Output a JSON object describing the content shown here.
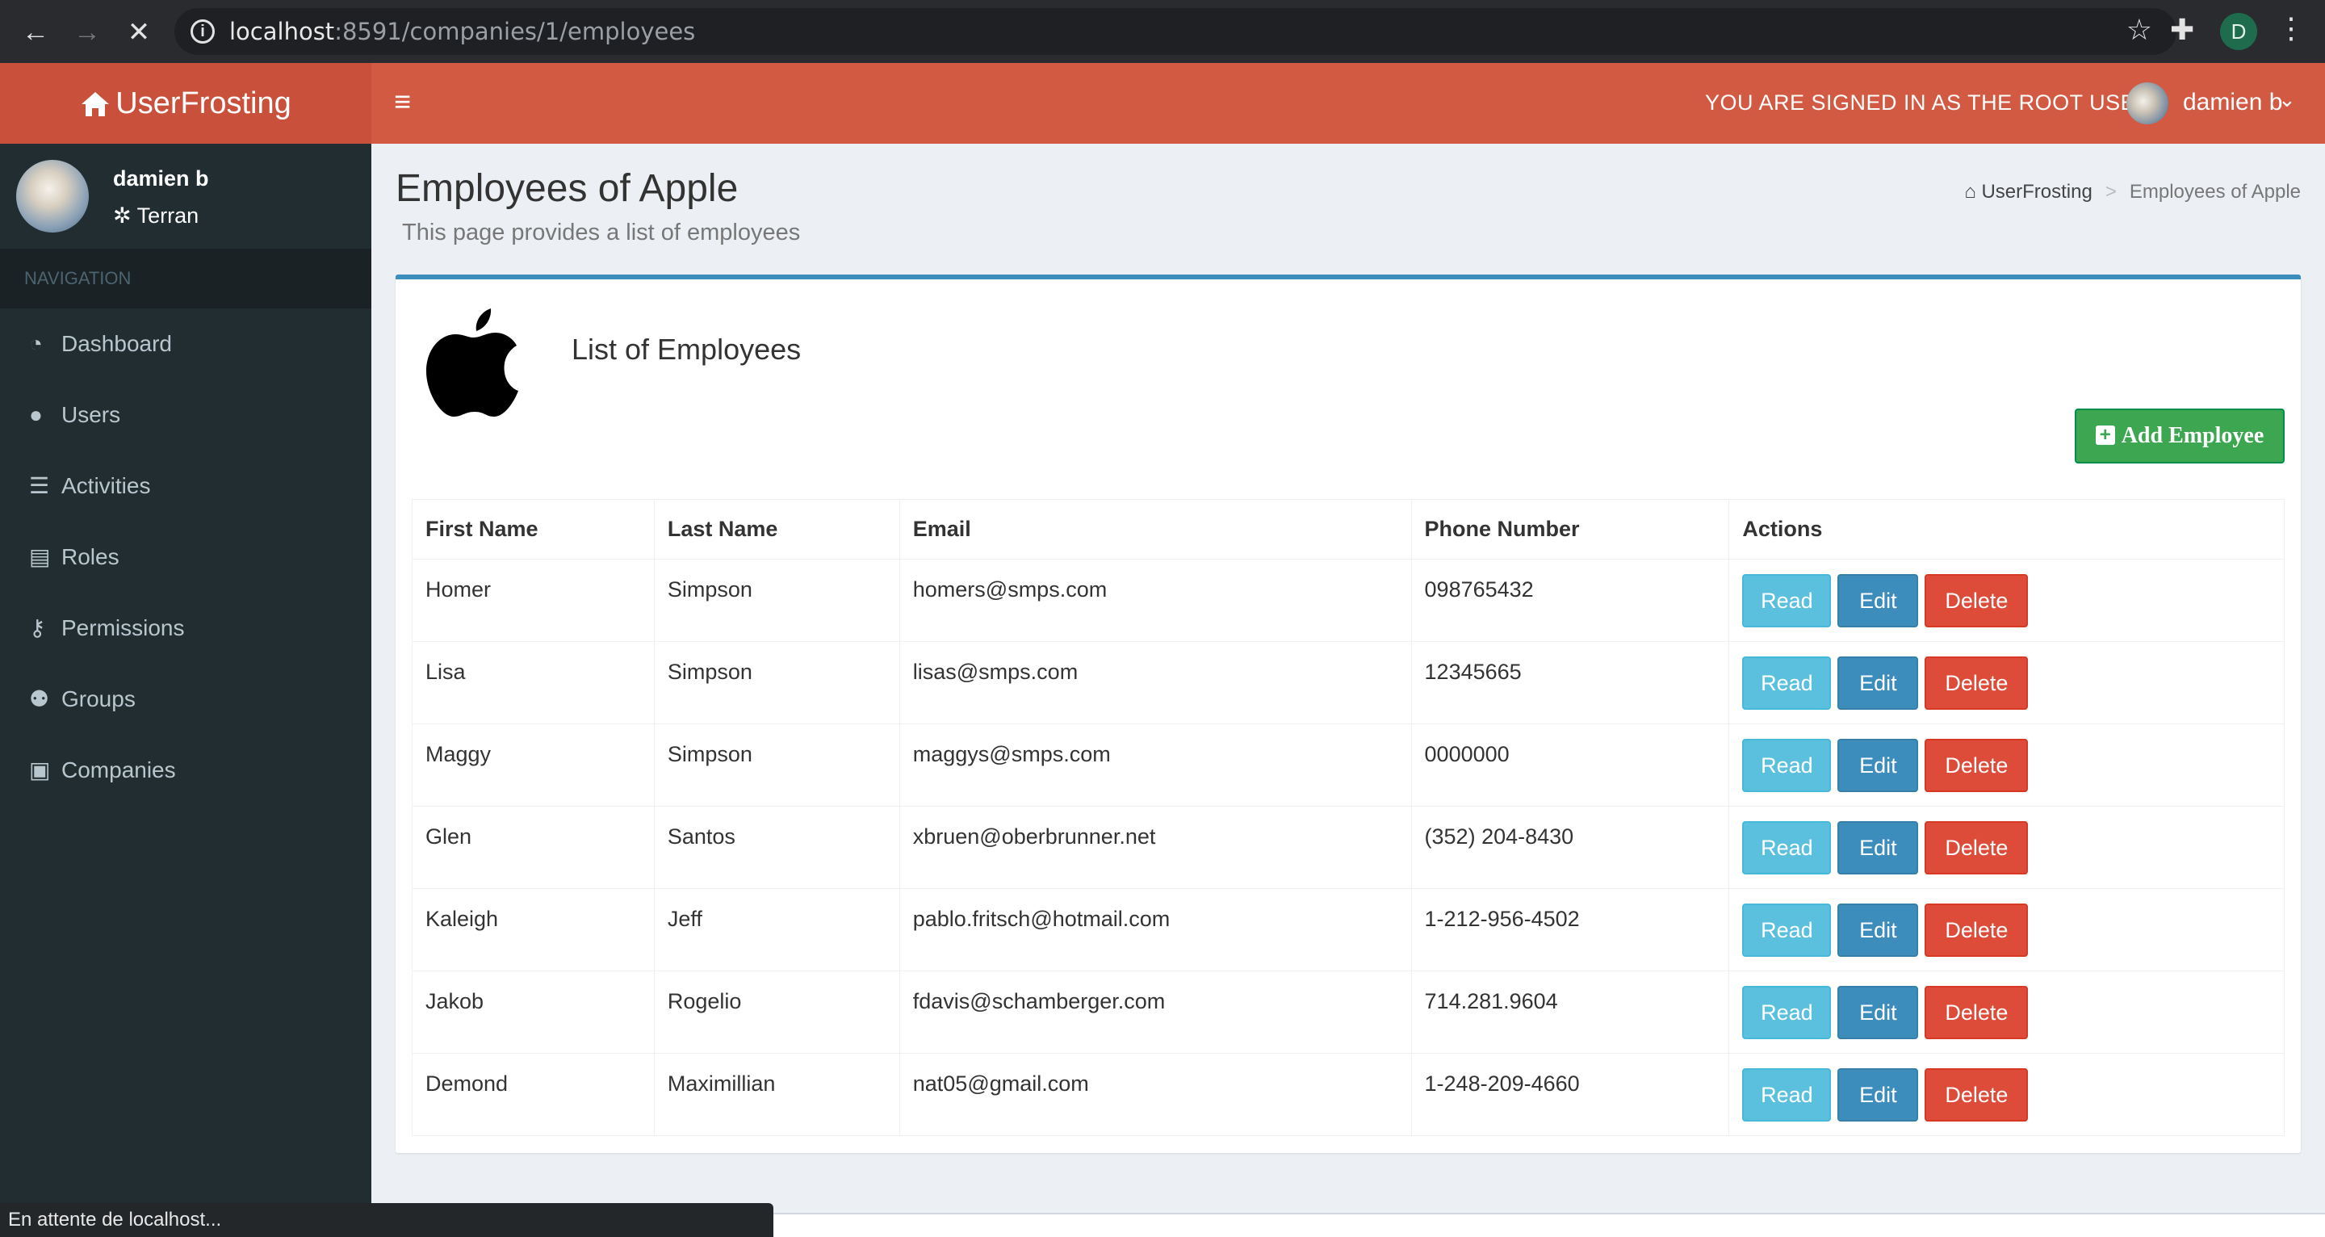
{
  "browser": {
    "url_host": "localhost",
    "url_path": ":8591/companies/1/employees",
    "profile_initial": "D",
    "status_text": "En attente de localhost..."
  },
  "topbar": {
    "brand": "UserFrosting",
    "root_message": "YOU ARE SIGNED IN AS THE ROOT USER",
    "user_name": "damien b"
  },
  "sidebar": {
    "user_name": "damien b",
    "user_role": "Terran",
    "nav_header": "NAVIGATION",
    "items": [
      {
        "label": "Dashboard",
        "icon": "dashboard-icon"
      },
      {
        "label": "Users",
        "icon": "user-icon"
      },
      {
        "label": "Activities",
        "icon": "list-icon"
      },
      {
        "label": "Roles",
        "icon": "id-card-icon"
      },
      {
        "label": "Permissions",
        "icon": "key-icon"
      },
      {
        "label": "Groups",
        "icon": "users-icon"
      },
      {
        "label": "Companies",
        "icon": "briefcase-icon"
      }
    ]
  },
  "page": {
    "title": "Employees of Apple",
    "subtitle": "This page provides a list of employees",
    "breadcrumb_home": "UserFrosting",
    "breadcrumb_current": "Employees of Apple"
  },
  "box": {
    "list_title": "List of Employees",
    "add_button": "Add Employee"
  },
  "table": {
    "headers": [
      "First Name",
      "Last Name",
      "Email",
      "Phone Number",
      "Actions"
    ],
    "actions": {
      "read": "Read",
      "edit": "Edit",
      "delete": "Delete"
    },
    "rows": [
      {
        "first": "Homer",
        "last": "Simpson",
        "email": "homers@smps.com",
        "phone": "098765432"
      },
      {
        "first": "Lisa",
        "last": "Simpson",
        "email": "lisas@smps.com",
        "phone": "12345665"
      },
      {
        "first": "Maggy",
        "last": "Simpson",
        "email": "maggys@smps.com",
        "phone": "0000000"
      },
      {
        "first": "Glen",
        "last": "Santos",
        "email": "xbruen@oberbrunner.net",
        "phone": "(352) 204-8430"
      },
      {
        "first": "Kaleigh",
        "last": "Jeff",
        "email": "pablo.fritsch@hotmail.com",
        "phone": "1-212-956-4502"
      },
      {
        "first": "Jakob",
        "last": "Rogelio",
        "email": "fdavis@schamberger.com",
        "phone": "714.281.9604"
      },
      {
        "first": "Demond",
        "last": "Maximillian",
        "email": "nat05@gmail.com",
        "phone": "1-248-209-4660"
      }
    ]
  },
  "colors": {
    "topbar": "#d25a43",
    "sidebar": "#222d32",
    "primary": "#3c8dbc",
    "success": "#00a65a",
    "danger": "#dd4b39",
    "info": "#5bc0de"
  }
}
